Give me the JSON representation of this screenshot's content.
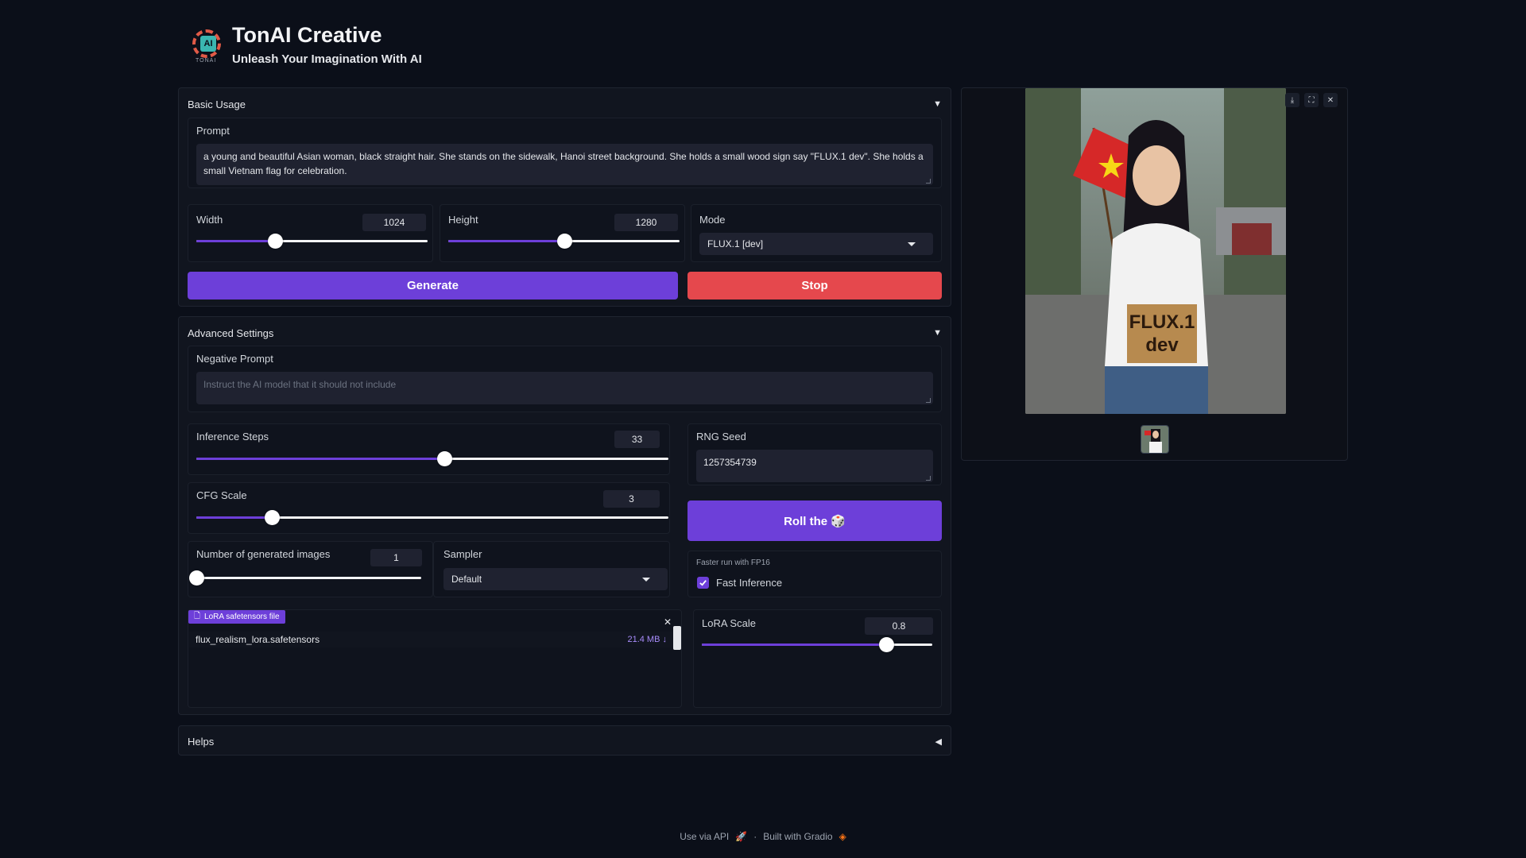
{
  "app": {
    "title": "TonAI Creative",
    "subtitle": "Unleash Your Imagination With AI",
    "logo_text": "AI",
    "logo_caption": "TONAI"
  },
  "basic_usage": {
    "header": "Basic Usage",
    "prompt_label": "Prompt",
    "prompt_value": "a young and beautiful Asian woman, black straight hair. She stands on the sidewalk, Hanoi street background. She holds a small wood sign say \"FLUX.1 dev\".  She holds a small Vietnam flag for celebration.",
    "width_label": "Width",
    "width_value": "1024",
    "width_fraction": 0.34,
    "height_label": "Height",
    "height_value": "1280",
    "height_fraction": 0.5,
    "mode_label": "Mode",
    "mode_value": "FLUX.1 [dev]",
    "generate_label": "Generate",
    "stop_label": "Stop"
  },
  "advanced": {
    "header": "Advanced Settings",
    "negative_label": "Negative Prompt",
    "negative_placeholder": "Instruct the AI model that it should not include",
    "steps_label": "Inference Steps",
    "steps_value": "33",
    "steps_fraction": 0.525,
    "seed_label": "RNG Seed",
    "seed_value": "1257354739",
    "cfg_label": "CFG Scale",
    "cfg_value": "3",
    "cfg_fraction": 0.16,
    "roll_label": "Roll the 🎲",
    "num_images_label": "Number of generated images",
    "num_images_value": "1",
    "num_images_fraction": 0.0,
    "sampler_label": "Sampler",
    "sampler_value": "Default",
    "fp16_info": "Faster run with FP16",
    "fast_inference_label": "Fast Inference",
    "fast_inference_checked": true,
    "lora_file_label": "LoRA safetensors file",
    "lora_file_name": "flux_realism_lora.safetensors",
    "lora_file_size": "21.4 MB ↓",
    "lora_scale_label": "LoRA Scale",
    "lora_scale_value": "0.8",
    "lora_scale_fraction": 0.8
  },
  "helps": {
    "header": "Helps"
  },
  "footer": {
    "api_label": "Use via API",
    "separator": "·",
    "built_label": "Built with Gradio"
  },
  "preview_sign": [
    "FLUX.1",
    "dev"
  ],
  "colors": {
    "accent": "#6d3fd9",
    "stop": "#e5484d",
    "background": "#0b0f19"
  }
}
